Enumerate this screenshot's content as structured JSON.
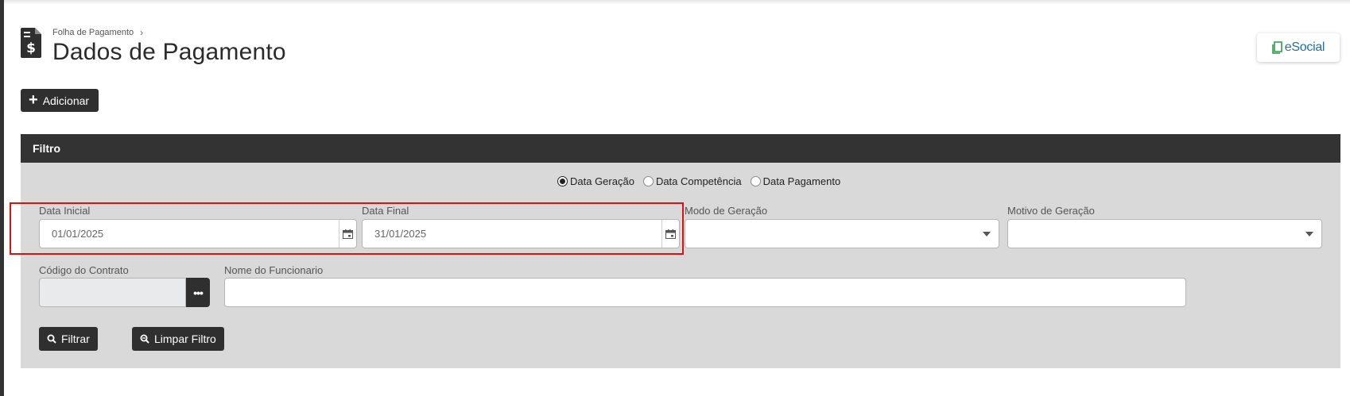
{
  "breadcrumb": {
    "parent": "Folha de Pagamento",
    "separator": "›"
  },
  "page": {
    "title": "Dados de Pagamento"
  },
  "esocial": {
    "label": "eSocial"
  },
  "toolbar": {
    "add_label": "Adicionar"
  },
  "filter": {
    "title": "Filtro",
    "date_type_options": [
      {
        "label": "Data Geração",
        "checked": true
      },
      {
        "label": "Data Competência",
        "checked": false
      },
      {
        "label": "Data Pagamento",
        "checked": false
      }
    ],
    "data_inicial": {
      "label": "Data Inicial",
      "value": "01/01/2025"
    },
    "data_final": {
      "label": "Data Final",
      "value": "31/01/2025"
    },
    "modo_geracao": {
      "label": "Modo de Geração",
      "value": ""
    },
    "motivo_geracao": {
      "label": "Motivo de Geração",
      "value": ""
    },
    "codigo_contrato": {
      "label": "Código do Contrato",
      "value": ""
    },
    "nome_funcionario": {
      "label": "Nome do Funcionario",
      "value": ""
    },
    "filtrar_label": "Filtrar",
    "limpar_label": "Limpar Filtro"
  },
  "colors": {
    "dark": "#2f2f2f",
    "panel": "#d9d9d9",
    "highlight": "#e01010",
    "esocial_blue": "#1f6fa8",
    "esocial_green": "#2e9a4a"
  }
}
